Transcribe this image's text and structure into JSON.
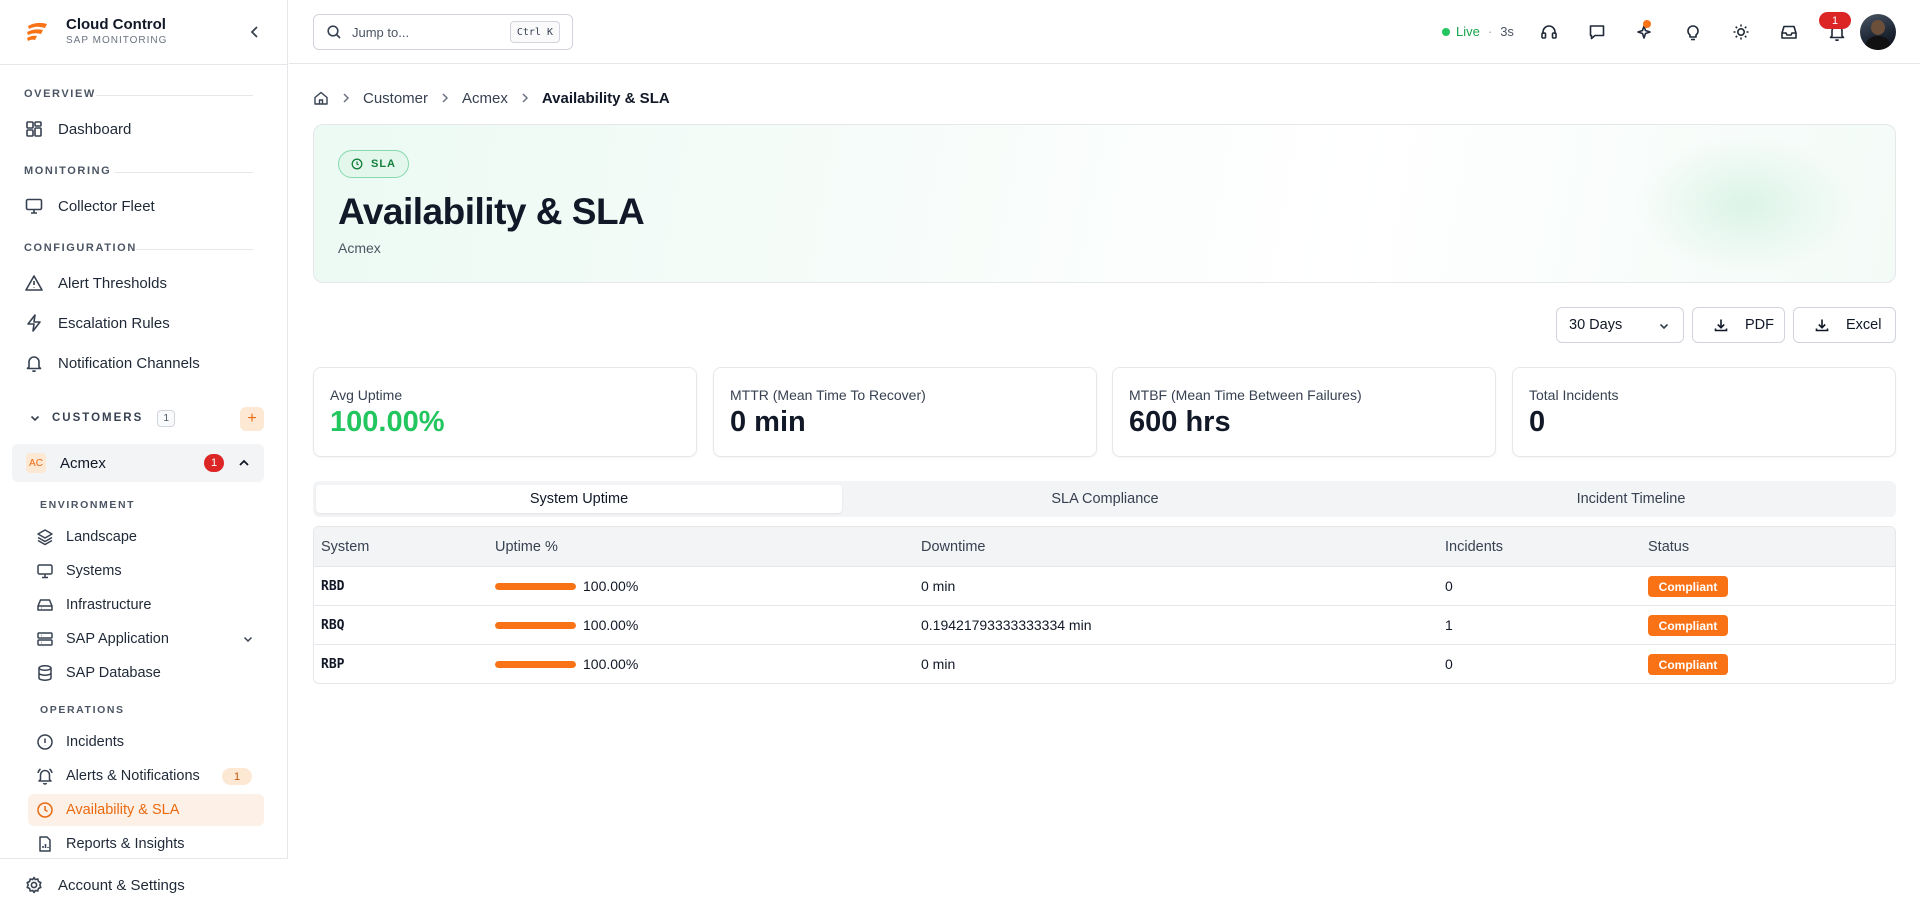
{
  "brand": {
    "title": "Cloud Control",
    "subtitle": "SAP MONITORING"
  },
  "sidebar": {
    "sections": {
      "overview": "OVERVIEW",
      "monitoring": "MONITORING",
      "configuration": "CONFIGURATION"
    },
    "items": {
      "dashboard": "Dashboard",
      "collector_fleet": "Collector Fleet",
      "alert_thresholds": "Alert Thresholds",
      "escalation_rules": "Escalation Rules",
      "notification_channels": "Notification Channels"
    },
    "customers": {
      "label": "CUSTOMERS",
      "count": "1",
      "add": "+"
    },
    "customer": {
      "initials": "AC",
      "name": "Acmex",
      "badge": "1"
    },
    "environment": {
      "label": "ENVIRONMENT",
      "landscape": "Landscape",
      "systems": "Systems",
      "infrastructure": "Infrastructure",
      "sap_application": "SAP Application",
      "sap_database": "SAP Database"
    },
    "operations": {
      "label": "OPERATIONS",
      "incidents": "Incidents",
      "alerts": "Alerts & Notifications",
      "alerts_count": "1",
      "availability": "Availability & SLA",
      "reports": "Reports & Insights"
    },
    "account": "Account & Settings"
  },
  "topbar": {
    "search_placeholder": "Jump to...",
    "shortcut": "Ctrl K",
    "live": "Live",
    "live_sep": "·",
    "interval": "3s",
    "notifications_count": "1"
  },
  "breadcrumb": {
    "customer": "Customer",
    "acmex": "Acmex",
    "current": "Availability & SLA"
  },
  "hero": {
    "tag": "SLA",
    "title": "Availability & SLA",
    "subtitle": "Acmex"
  },
  "controls": {
    "range": "30 Days",
    "pdf": "PDF",
    "excel": "Excel"
  },
  "kpis": [
    {
      "label": "Avg Uptime",
      "value": "100.00%"
    },
    {
      "label": "MTTR (Mean Time To Recover)",
      "value": "0 min"
    },
    {
      "label": "MTBF (Mean Time Between Failures)",
      "value": "600 hrs"
    },
    {
      "label": "Total Incidents",
      "value": "0"
    }
  ],
  "tabs": [
    "System Uptime",
    "SLA Compliance",
    "Incident Timeline"
  ],
  "table": {
    "headers": [
      "System",
      "Uptime %",
      "Downtime",
      "Incidents",
      "Status"
    ],
    "rows": [
      {
        "system": "RBD",
        "uptime": "100.00%",
        "uptime_fraction": 1.0,
        "downtime": "0 min",
        "incidents": "0",
        "status": "Compliant"
      },
      {
        "system": "RBQ",
        "uptime": "100.00%",
        "uptime_fraction": 1.0,
        "downtime": "0.19421793333333334 min",
        "incidents": "1",
        "status": "Compliant"
      },
      {
        "system": "RBP",
        "uptime": "100.00%",
        "uptime_fraction": 1.0,
        "downtime": "0 min",
        "incidents": "0",
        "status": "Compliant"
      }
    ]
  },
  "colors": {
    "accent": "#f97316",
    "success": "#22c55e",
    "danger": "#dc2626"
  }
}
